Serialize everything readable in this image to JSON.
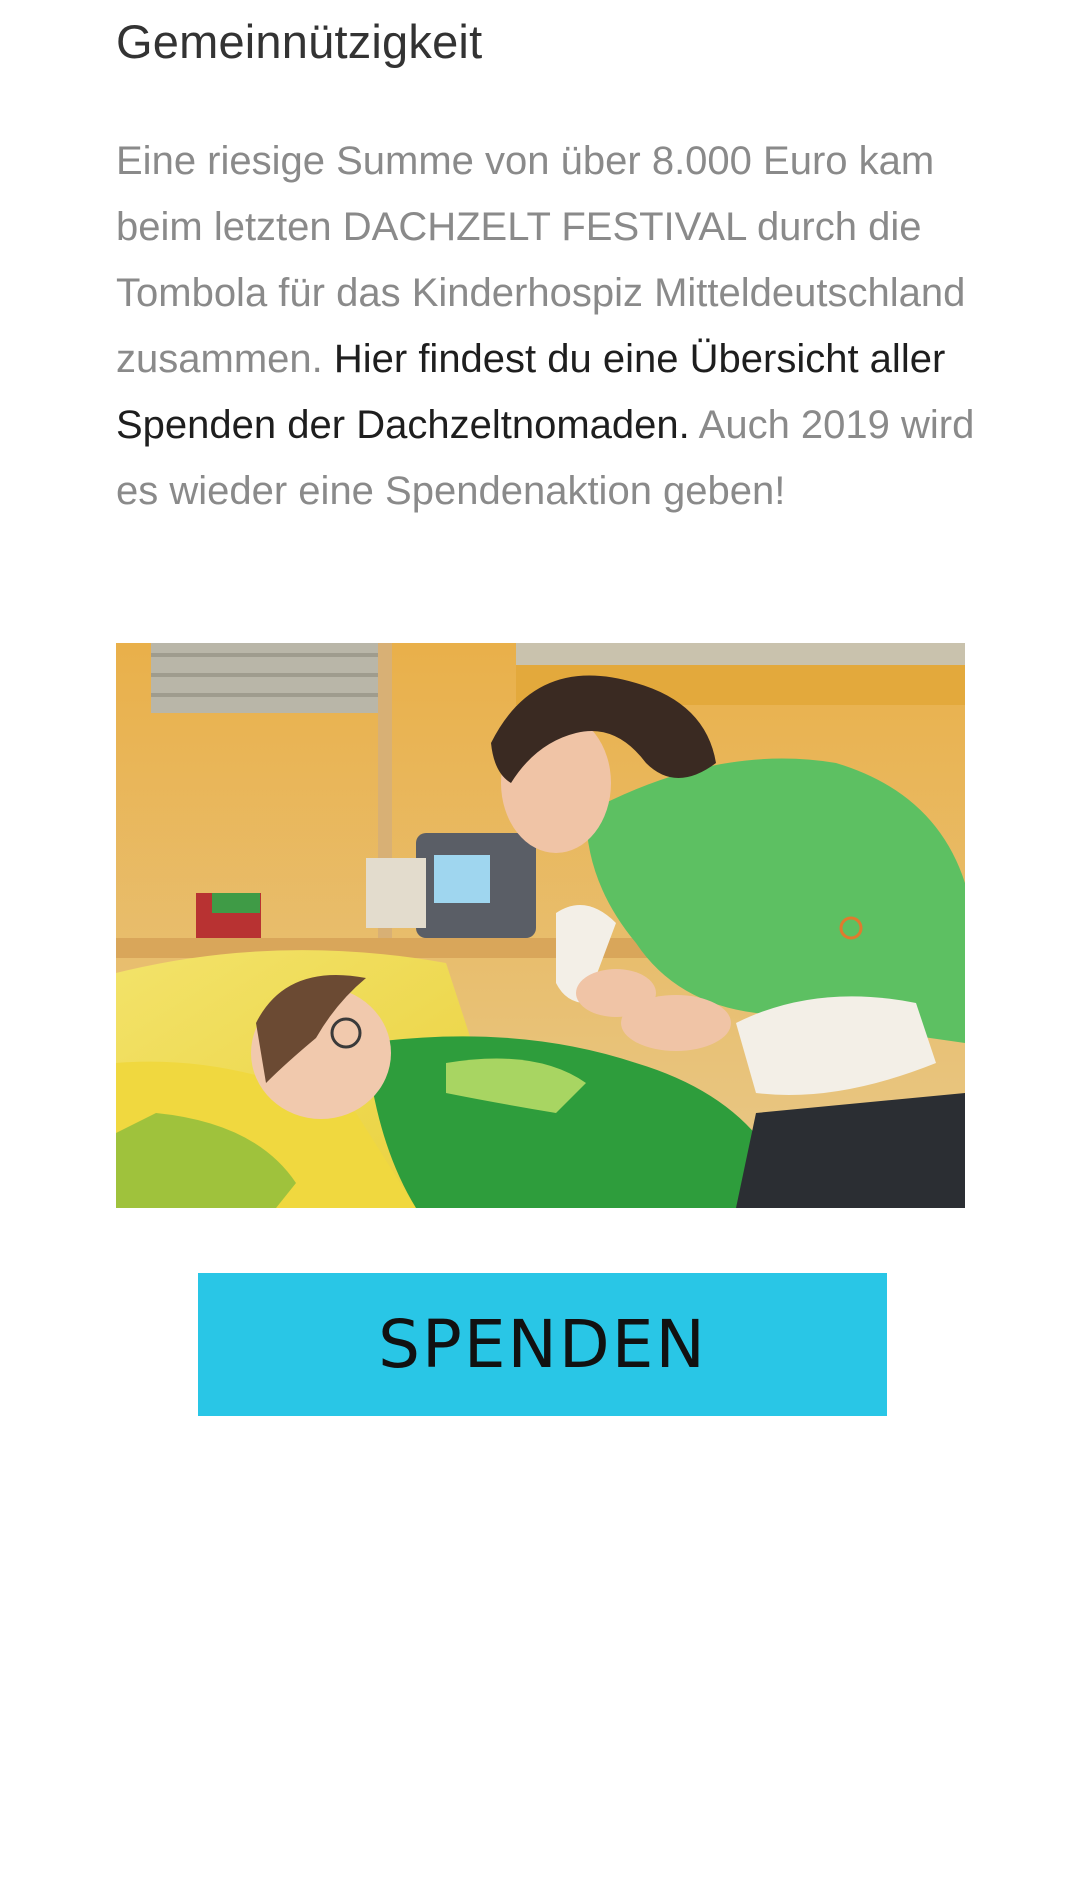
{
  "section": {
    "heading": "Gemeinnützigkeit",
    "paragraph": {
      "part1": "Eine riesige Summe von über 8.000 Euro kam beim letzten DACHZELT FESTIVAL durch die Tombola für das Kinderhospiz Mitteldeutschland  zusammen. ",
      "link_text": "Hier findest du eine Übersicht aller Spenden der Dachzeltnomaden.",
      "part2": " Auch 2019 wird es wieder eine Spendenaktion geben!"
    }
  },
  "photo": {
    "subject": "caregiver-with-child-in-hospice-bed"
  },
  "donate_button": {
    "label": "SPENDEN",
    "color": "#29c6e6"
  },
  "colors": {
    "heading": "#333333",
    "body_text": "#8a8a8a",
    "link_text": "#1e1e1e"
  }
}
